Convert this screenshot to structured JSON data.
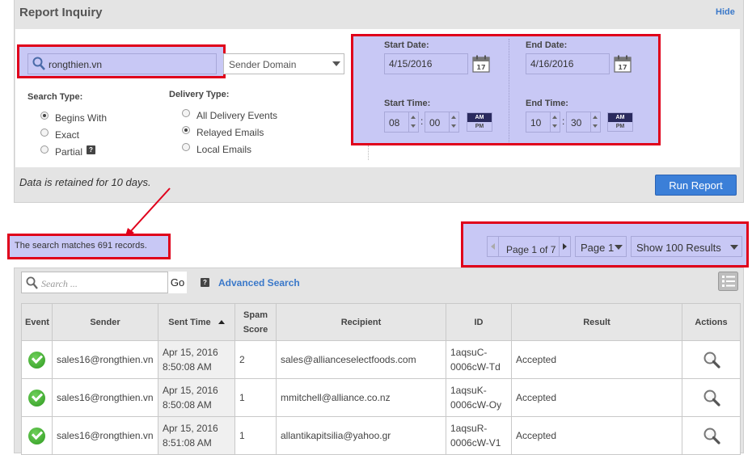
{
  "panel": {
    "title": "Report Inquiry",
    "hide_label": "Hide",
    "domain_value": "rongthien.vn",
    "sender_select": "Sender Domain",
    "search_type": {
      "label": "Search Type:",
      "options": [
        "Begins With",
        "Exact",
        "Partial"
      ],
      "selected": "Begins With"
    },
    "delivery_type": {
      "label": "Delivery Type:",
      "options": [
        "All Delivery Events",
        "Relayed Emails",
        "Local Emails"
      ],
      "selected": "Relayed Emails"
    },
    "start_date_label": "Start Date:",
    "start_date": "4/15/2016",
    "end_date_label": "End Date:",
    "end_date": "4/16/2016",
    "start_time_label": "Start Time:",
    "start_hour": "08",
    "start_min": "00",
    "end_time_label": "End Time:",
    "end_hour": "10",
    "end_min": "30",
    "am": "AM",
    "pm": "PM",
    "calendar_day": "17",
    "colon": ":",
    "retained": "Data is retained for 10 days.",
    "run_label": "Run Report"
  },
  "matches": "The search matches 691 records.",
  "pager": {
    "page_of": "Page 1 of 7",
    "page_select": "Page 1",
    "show_select": "Show 100 Results"
  },
  "grid": {
    "search_placeholder": "Search ...",
    "go_label": "Go",
    "advanced_label": "Advanced Search",
    "headers": {
      "event": "Event",
      "sender": "Sender",
      "sent_time": "Sent Time",
      "spam": "Spam Score",
      "recipient": "Recipient",
      "id": "ID",
      "result": "Result",
      "actions": "Actions"
    },
    "rows": [
      {
        "sender": "sales16@rongthien.vn",
        "date": "Apr 15, 2016",
        "time": "8:50:08 AM",
        "spam": "2",
        "recipient": "sales@allianceselectfoods.com",
        "id1": "1aqsuC-",
        "id2": "0006cW-Td",
        "result": "Accepted"
      },
      {
        "sender": "sales16@rongthien.vn",
        "date": "Apr 15, 2016",
        "time": "8:50:08 AM",
        "spam": "1",
        "recipient": "mmitchell@alliance.co.nz",
        "id1": "1aqsuK-",
        "id2": "0006cW-Oy",
        "result": "Accepted"
      },
      {
        "sender": "sales16@rongthien.vn",
        "date": "Apr 15, 2016",
        "time": "8:51:08 AM",
        "spam": "1",
        "recipient": "allantikapitsilia@yahoo.gr",
        "id1": "1aqsuR-",
        "id2": "0006cW-V1",
        "result": "Accepted"
      }
    ]
  },
  "colors": {
    "highlight_border": "#e0001b",
    "highlight_fill": "#c8c8f5",
    "link": "#3a78c9",
    "button": "#3b7fd8"
  },
  "icons": [
    "search-icon",
    "calendar-icon",
    "help-icon",
    "check-icon",
    "magnifier-icon",
    "list-view-icon",
    "sort-ascending-icon"
  ]
}
